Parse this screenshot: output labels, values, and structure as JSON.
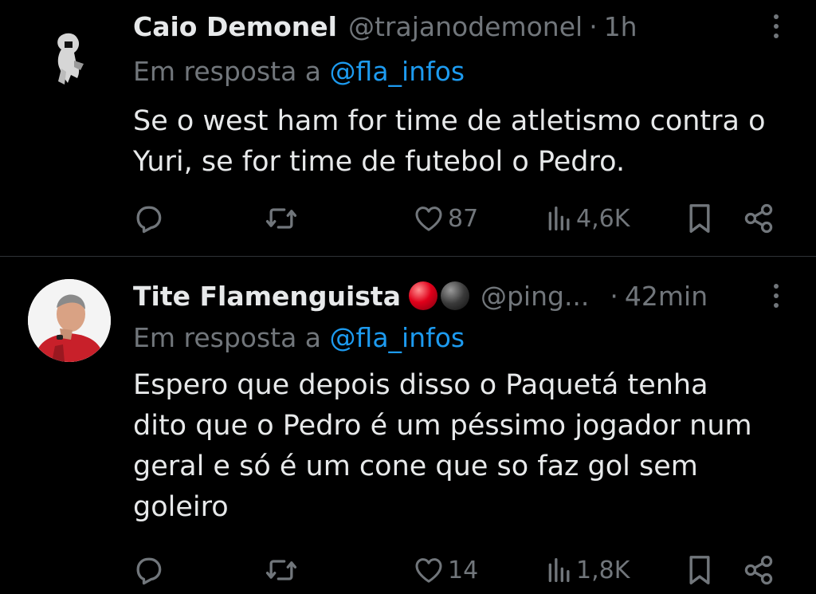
{
  "tweets": [
    {
      "name": "Caio Demonel",
      "handle": "@trajanodemonel",
      "separator": "·",
      "time": "1h",
      "reply_prefix": "Em resposta a",
      "reply_handle": "@fla_infos",
      "text": "Se o west ham for time de atletismo contra o\nYuri, se for time de futebol o Pedro.",
      "likes": "87",
      "views": "4,6K"
    },
    {
      "name": "Tite Flamenguista",
      "name_emojis": [
        "red-ball-emoji",
        "black-ball-emoji"
      ],
      "handle": "@ping...",
      "separator": "·",
      "time": "42min",
      "reply_prefix": "Em resposta a",
      "reply_handle": "@fla_infos",
      "text": "Espero que depois disso o Paquetá tenha\ndito que o Pedro é um péssimo jogador num\ngeral e só é um cone que so faz gol sem\ngoleiro",
      "likes": "14",
      "views": "1,8K"
    }
  ],
  "colors": {
    "background": "#000000",
    "text": "#e7e9ea",
    "secondary": "#71767b",
    "accent": "#1d9bf0",
    "divider": "#2f3336"
  },
  "icons": [
    "reply-icon",
    "retweet-icon",
    "like-icon",
    "views-icon",
    "bookmark-icon",
    "share-icon",
    "more-icon"
  ]
}
